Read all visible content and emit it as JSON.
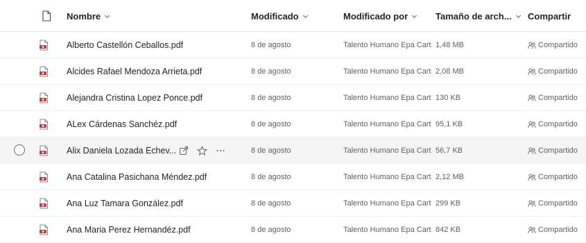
{
  "header": {
    "name": "Nombre",
    "modified": "Modificado",
    "modified_by": "Modificado por",
    "file_size": "Tamaño de arch...",
    "share": "Compartir"
  },
  "files": [
    {
      "name": "Alberto Castellón Ceballos.pdf",
      "modified": "8 de agosto",
      "modified_by": "Talento Humano Epa Carta",
      "size": "1,48 MB",
      "share": "Compartido"
    },
    {
      "name": "Alcides Rafael Mendoza Arrieta.pdf",
      "modified": "8 de agosto",
      "modified_by": "Talento Humano Epa Carta",
      "size": "2,08 MB",
      "share": "Compartido"
    },
    {
      "name": "Alejandra Cristina Lopez Ponce.pdf",
      "modified": "8 de agosto",
      "modified_by": "Talento Humano Epa Carta",
      "size": "130 KB",
      "share": "Compartido"
    },
    {
      "name": "ALex Cárdenas Sanchéz.pdf",
      "modified": "8 de agosto",
      "modified_by": "Talento Humano Epa Carta",
      "size": "95,1 KB",
      "share": "Compartido"
    },
    {
      "name": "Alix Daniela Lozada Echev...",
      "modified": "8 de agosto",
      "modified_by": "Talento Humano Epa Carta",
      "size": "56,7 KB",
      "share": "Compartido"
    },
    {
      "name": "Ana Catalina Pasichana Méndez.pdf",
      "modified": "8 de agosto",
      "modified_by": "Talento Humano Epa Carta",
      "size": "2,12 MB",
      "share": "Compartido"
    },
    {
      "name": "Ana Luz Tamara González.pdf",
      "modified": "8 de agosto",
      "modified_by": "Talento Humano Epa Carta",
      "size": "299 KB",
      "share": "Compartido"
    },
    {
      "name": "Ana Maria Perez Hernandéz.pdf",
      "modified": "8 de agosto",
      "modified_by": "Talento Humano Epa Carta",
      "size": "842 KB",
      "share": "Compartido"
    }
  ],
  "hover_row_index": 4,
  "icons": {
    "file_type": "document-icon",
    "pdf": "pdf-file-icon",
    "share": "people-icon",
    "chevron": "chevron-down-icon",
    "row_share_action": "share-icon",
    "row_favorite_action": "star-icon",
    "row_more_action": "more-icon"
  },
  "colors": {
    "pdf_red": "#d13438",
    "hover_bg": "#f5f5f5"
  }
}
